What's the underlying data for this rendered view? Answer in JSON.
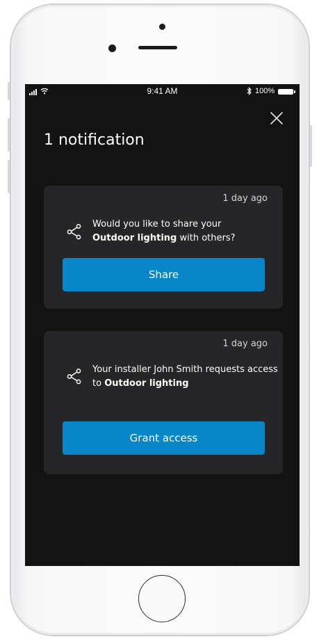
{
  "status_bar": {
    "time": "9:41 AM",
    "battery": "100%"
  },
  "header": {
    "title": "1 notification"
  },
  "notifications": [
    {
      "time": "1 day ago",
      "line1": "Would you like to share your",
      "bold": "Outdoor lighting",
      "line2_suffix": " with others?",
      "button": "Share"
    },
    {
      "time": "1 day ago",
      "line1": "Your installer John Smith requests access",
      "line2_prefix": "to ",
      "bold": "Outdoor lighting",
      "button": "Grant access"
    }
  ],
  "colors": {
    "screen_bg": "#131313",
    "card_bg": "#262628",
    "accent": "#0786c9"
  },
  "icons": [
    "signal-icon",
    "wifi-icon",
    "bluetooth-icon",
    "battery-icon",
    "close-icon",
    "share-icon"
  ]
}
